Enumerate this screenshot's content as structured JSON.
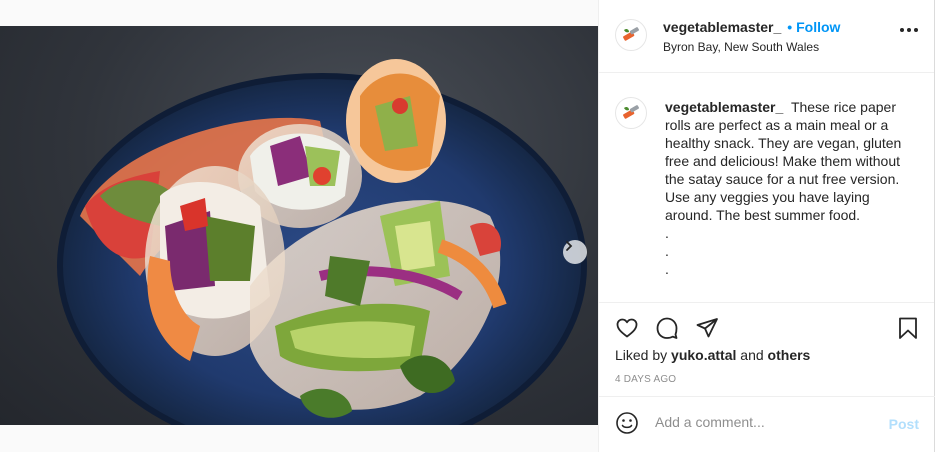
{
  "post": {
    "username": "vegetablemaster_",
    "follow_separator": "•",
    "follow_label": "Follow",
    "location": "Byron Bay, New South Wales",
    "caption_text": "These rice paper rolls are perfect as a main meal or a healthy snack. They are vegan, gluten free and delicious! Make them without the satay sauce for a nut free version. Use any veggies you have laying around. The best summer food.",
    "caption_dots": [
      ".",
      ".",
      "."
    ],
    "liked_prefix": "Liked by",
    "liked_user": "yuko.attal",
    "liked_and": "and",
    "liked_others": "others",
    "time_ago": "4 DAYS AGO",
    "comment_placeholder": "Add a comment...",
    "post_label": "Post"
  },
  "carousel": {
    "slide_count": 2,
    "active_index": 0
  },
  "icons": {
    "avatar": "knife-vegetable-icon",
    "like": "heart-icon",
    "comment": "comment-bubble-icon",
    "share": "paper-plane-icon",
    "save": "bookmark-icon",
    "emoji": "smiley-icon",
    "next": "chevron-right-icon",
    "more": "more-options-icon"
  },
  "colors": {
    "follow": "#0095f6",
    "post_disabled": "#b2dffc",
    "muted": "#8e8e8e"
  }
}
